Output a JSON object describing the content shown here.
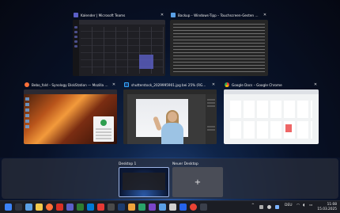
{
  "windows": {
    "teams": {
      "title": "Kalender | Microsoft Teams",
      "close": "✕"
    },
    "notepad": {
      "title": "Backup – Windows-Tipp – Touchscreen-Gesten - 150325_...",
      "close": "✕"
    },
    "firefox": {
      "title": "Bebo_fold – Synology DiskStation — Mozilla Firefox",
      "close": "✕"
    },
    "photoshop": {
      "title": "shutterstock_2029995901.jpg bei 25% (RGB/8#)",
      "close": "✕"
    },
    "chrome": {
      "title": "Google Docs – Google Chrome",
      "close": "✕"
    }
  },
  "desktops": {
    "desktop1": {
      "label": "Desktop 1"
    },
    "new_desktop": {
      "label": "Neuer Desktop",
      "plus": "+"
    }
  },
  "taskbar": {
    "tray_expand": "^",
    "language": "DEU",
    "time": "11:08",
    "date": "15.03.2025"
  },
  "colors": {
    "accent": "#5b5fc7",
    "taskbar_bg": "#1b1d24"
  }
}
